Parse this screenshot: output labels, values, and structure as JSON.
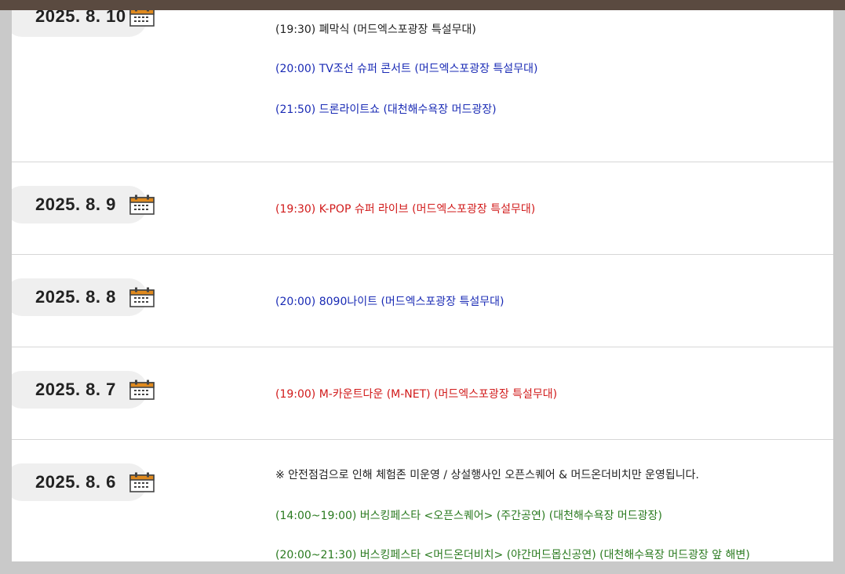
{
  "colors": {
    "blue": "#1a2bb5",
    "red": "#d11a1a",
    "green": "#2a7a1f",
    "default": "#222222",
    "calendar_header": "#e08a1e"
  },
  "days": [
    {
      "date": "2025. 8. 10",
      "icon": "calendar-icon",
      "events": [
        {
          "text": "(19:30) 폐막식 (머드엑스포광장 특설무대)",
          "color": "default"
        },
        {
          "text": "(20:00) TV조선 슈퍼 콘서트 (머드엑스포광장 특설무대)",
          "color": "blue"
        },
        {
          "text": "(21:50) 드론라이트쇼 (대천해수욕장 머드광장)",
          "color": "blue"
        }
      ]
    },
    {
      "date": "2025. 8. 9",
      "icon": "calendar-icon",
      "events": [
        {
          "text": "(19:30) K-POP 슈퍼 라이브 (머드엑스포광장 특설무대)",
          "color": "red"
        }
      ]
    },
    {
      "date": "2025. 8. 8",
      "icon": "calendar-icon",
      "events": [
        {
          "text": "(20:00) 8090나이트 (머드엑스포광장 특설무대)",
          "color": "blue"
        }
      ]
    },
    {
      "date": "2025. 8. 7",
      "icon": "calendar-icon",
      "events": [
        {
          "text": "(19:00) M-카운트다운 (M-NET) (머드엑스포광장 특설무대)",
          "color": "red"
        }
      ]
    },
    {
      "date": "2025. 8. 6",
      "icon": "calendar-icon",
      "events": [
        {
          "text": "※ 안전점검으로 인해 체험존 미운영 / 상설행사인 오픈스퀘어 & 머드온더비치만 운영됩니다.",
          "color": "default"
        },
        {
          "text": "(14:00~19:00) 버스킹페스타 <오픈스퀘어> (주간공연)  (대천해수욕장 머드광장)",
          "color": "green"
        },
        {
          "text": "(20:00~21:30) 버스킹페스타 <머드온더비치> (야간머드몹신공연)  (대천해수욕장 머드광장 앞 해변)",
          "color": "green"
        }
      ]
    }
  ]
}
